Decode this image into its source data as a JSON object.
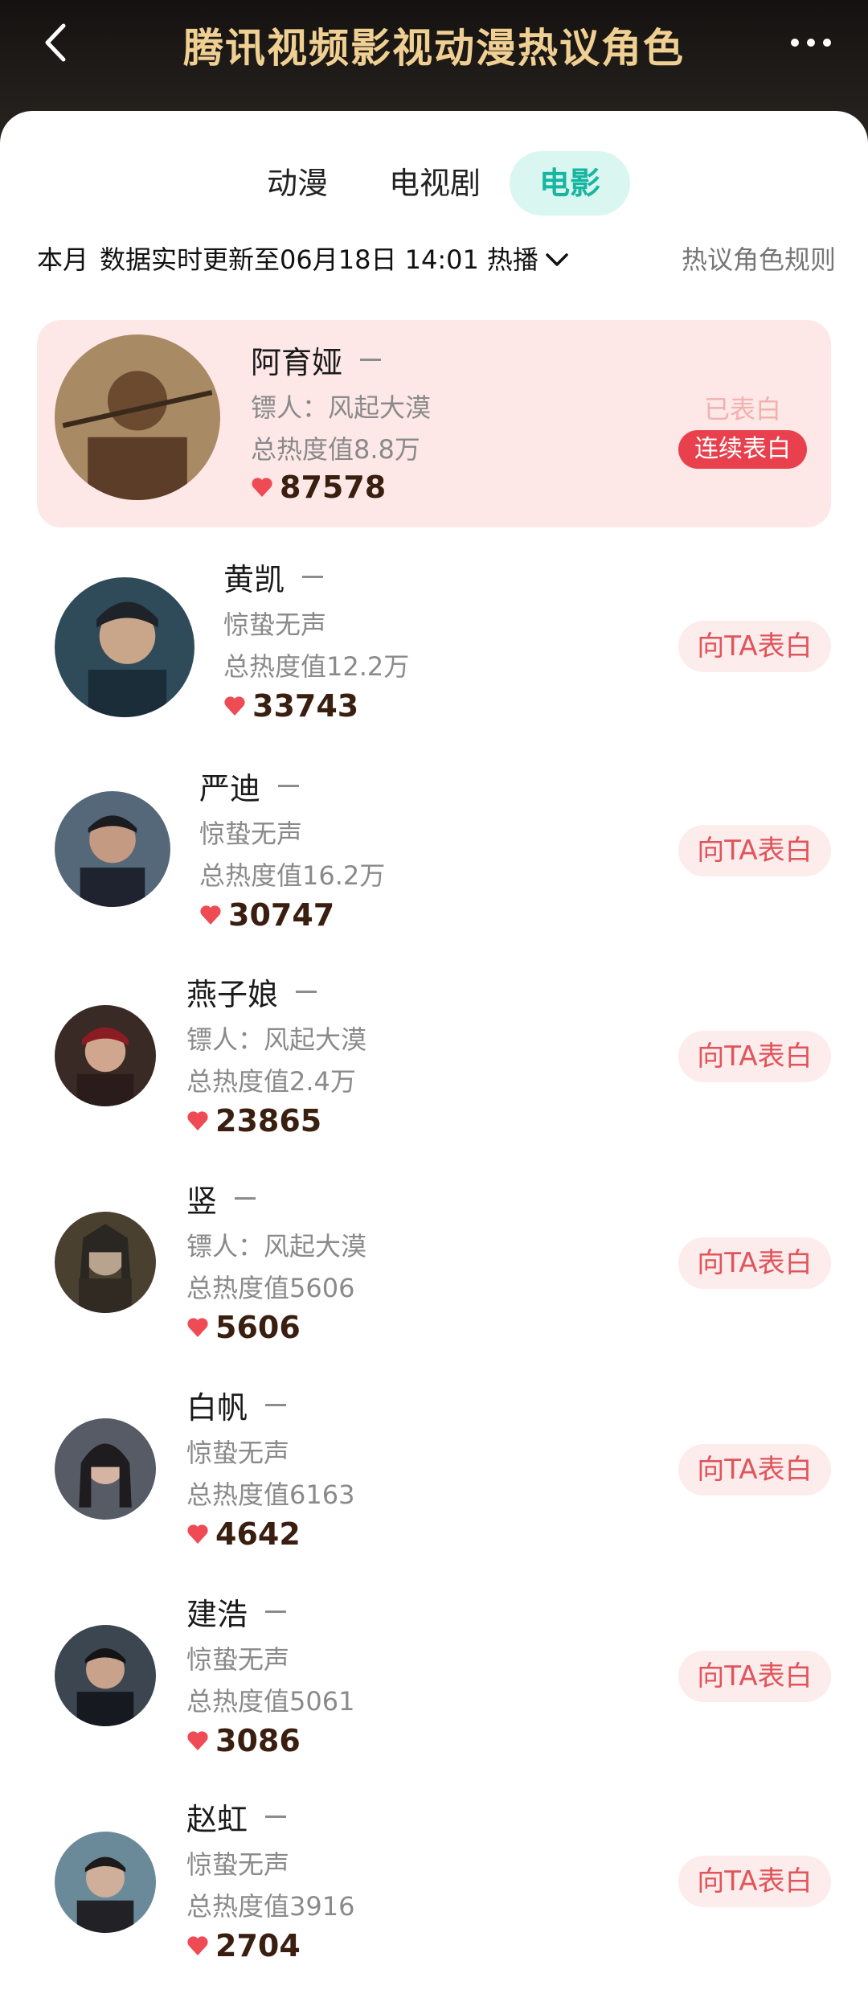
{
  "header": {
    "title": "腾讯视频影视动漫热议角色",
    "background": "#1a1714",
    "title_color": "#f0cf93"
  },
  "tabs": [
    {
      "label": "动漫",
      "active": false
    },
    {
      "label": "电视剧",
      "active": false
    },
    {
      "label": "电影",
      "active": true
    }
  ],
  "info": {
    "period": "本月",
    "update_text": "数据实时更新至06月18日 14:01",
    "sort_label": "热播",
    "rules_link": "热议角色规则"
  },
  "accent": {
    "highlight_bg": "#fde8e7",
    "button_bg": "#fdecec",
    "button_text": "#e0545a",
    "streak_bg": "#e8404d",
    "tab_active_text": "#16b6a0",
    "tab_active_bg": "#d9f6f0"
  },
  "characters": [
    {
      "name": "阿育娅",
      "work": "镖人：风起大漠",
      "heat": "总热度值8.8万",
      "likes": "87578",
      "confessed_label": "已表白",
      "streak_label": "连续表白"
    },
    {
      "name": "黄凯",
      "work": "惊蛰无声",
      "heat": "总热度值12.2万",
      "likes": "33743",
      "button": "向TA表白"
    },
    {
      "name": "严迪",
      "work": "惊蛰无声",
      "heat": "总热度值16.2万",
      "likes": "30747",
      "button": "向TA表白"
    },
    {
      "name": "燕子娘",
      "work": "镖人：风起大漠",
      "heat": "总热度值2.4万",
      "likes": "23865",
      "button": "向TA表白"
    },
    {
      "name": "竖",
      "work": "镖人：风起大漠",
      "heat": "总热度值5606",
      "likes": "5606",
      "button": "向TA表白"
    },
    {
      "name": "白帆",
      "work": "惊蛰无声",
      "heat": "总热度值6163",
      "likes": "4642",
      "button": "向TA表白"
    },
    {
      "name": "建浩",
      "work": "惊蛰无声",
      "heat": "总热度值5061",
      "likes": "3086",
      "button": "向TA表白"
    },
    {
      "name": "赵虹",
      "work": "惊蛰无声",
      "heat": "总热度值3916",
      "likes": "2704",
      "button": "向TA表白"
    }
  ]
}
